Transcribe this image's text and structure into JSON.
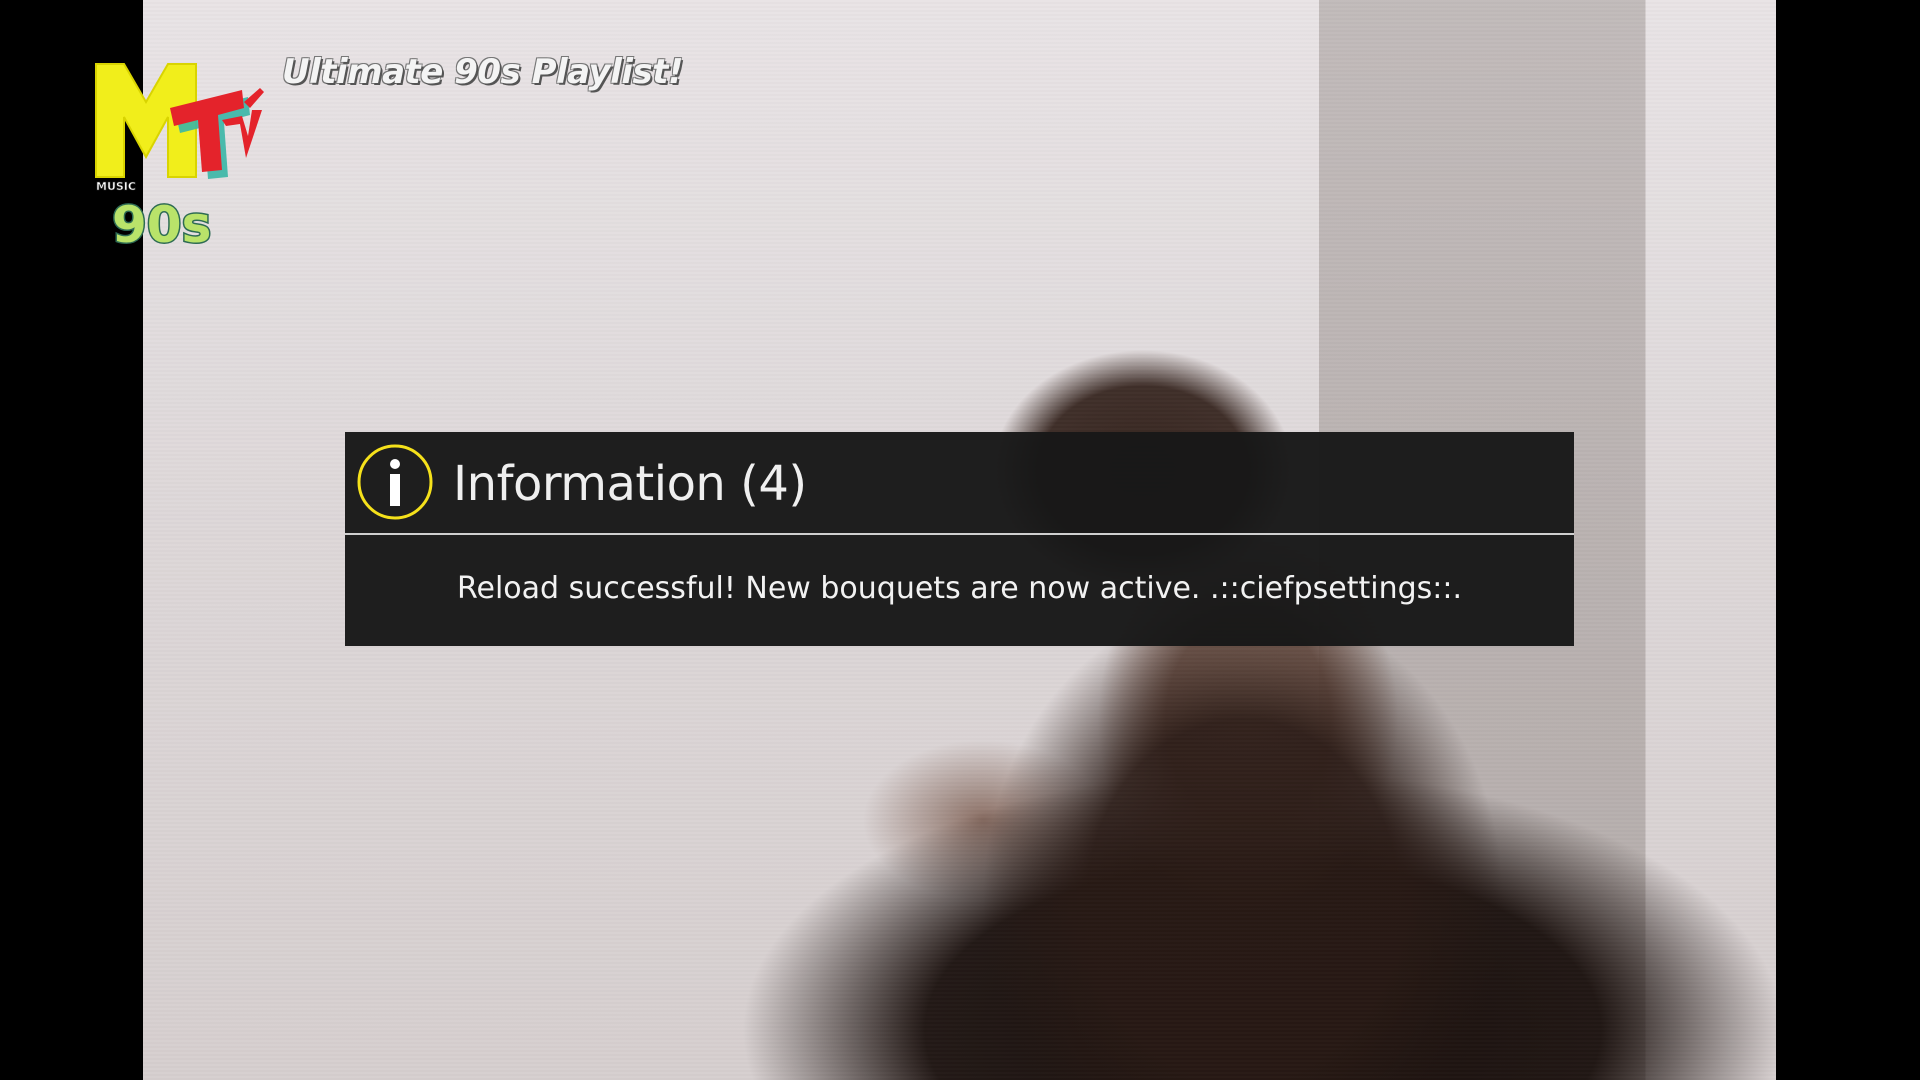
{
  "channel": {
    "logo_text": "MTV",
    "logo_small_text": "MUSIC",
    "logo_decade": "90s",
    "program_title": "Ultimate 90s Playlist!"
  },
  "message_box": {
    "title": "Information (4)",
    "icon": "info-icon",
    "message": "Reload successful! New bouquets are now active. .::ciefpsettings::.",
    "icon_color": "#f5e11b"
  },
  "colors": {
    "logo_yellow": "#f1ee1b",
    "logo_red": "#e4232b",
    "logo_green": "#b9e36a",
    "dialog_background": "#181818"
  }
}
